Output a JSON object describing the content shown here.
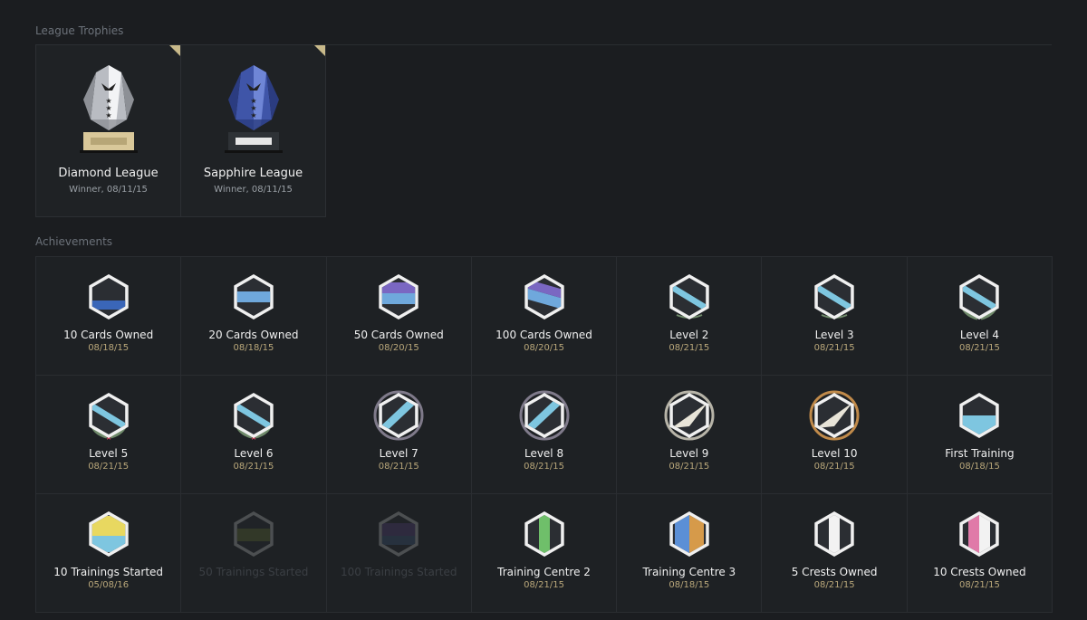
{
  "sections": {
    "trophies_title": "League Trophies",
    "achievements_title": "Achievements"
  },
  "trophies": [
    {
      "name": "Diamond League",
      "sub": "Winner, 08/11/15",
      "style": "diamond"
    },
    {
      "name": "Sapphire League",
      "sub": "Winner, 08/11/15",
      "style": "sapphire"
    }
  ],
  "achievements": [
    {
      "name": "10 Cards Owned",
      "date": "08/18/15",
      "badge": "cards-1",
      "locked": false
    },
    {
      "name": "20 Cards Owned",
      "date": "08/18/15",
      "badge": "cards-2",
      "locked": false
    },
    {
      "name": "50 Cards Owned",
      "date": "08/20/15",
      "badge": "cards-3",
      "locked": false
    },
    {
      "name": "100 Cards Owned",
      "date": "08/20/15",
      "badge": "cards-4",
      "locked": false
    },
    {
      "name": "Level 2",
      "date": "08/21/15",
      "badge": "level-small",
      "locked": false
    },
    {
      "name": "Level 3",
      "date": "08/21/15",
      "badge": "level-small",
      "locked": false
    },
    {
      "name": "Level 4",
      "date": "08/21/15",
      "badge": "level-wreath",
      "locked": false
    },
    {
      "name": "Level 5",
      "date": "08/21/15",
      "badge": "level-wreath-star",
      "locked": false
    },
    {
      "name": "Level 6",
      "date": "08/21/15",
      "badge": "level-wreath-star",
      "locked": false
    },
    {
      "name": "Level 7",
      "date": "08/21/15",
      "badge": "level-shield",
      "locked": false
    },
    {
      "name": "Level 8",
      "date": "08/21/15",
      "badge": "level-shield",
      "locked": false
    },
    {
      "name": "Level 9",
      "date": "08/21/15",
      "badge": "level-silver",
      "locked": false
    },
    {
      "name": "Level 10",
      "date": "08/21/15",
      "badge": "level-gold",
      "locked": false
    },
    {
      "name": "First Training",
      "date": "08/18/15",
      "badge": "training-first",
      "locked": false
    },
    {
      "name": "10 Trainings Started",
      "date": "05/08/16",
      "badge": "training-yellow",
      "locked": false
    },
    {
      "name": "50 Trainings Started",
      "date": "",
      "badge": "training-locked-a",
      "locked": true
    },
    {
      "name": "100 Trainings Started",
      "date": "",
      "badge": "training-locked-b",
      "locked": true
    },
    {
      "name": "Training Centre 2",
      "date": "08/21/15",
      "badge": "centre-green",
      "locked": false
    },
    {
      "name": "Training Centre 3",
      "date": "08/18/15",
      "badge": "centre-blue-orange",
      "locked": false
    },
    {
      "name": "5 Crests Owned",
      "date": "08/21/15",
      "badge": "crest-white",
      "locked": false
    },
    {
      "name": "10 Crests Owned",
      "date": "08/21/15",
      "badge": "crest-pink",
      "locked": false
    }
  ]
}
